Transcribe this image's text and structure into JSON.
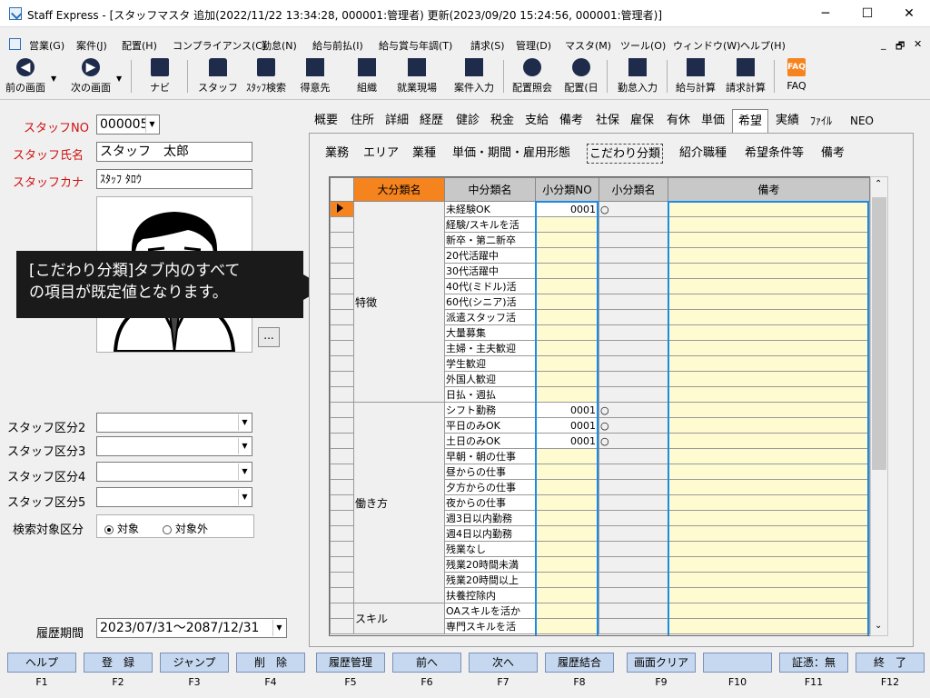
{
  "window": {
    "title": "Staff Express - [スタッフマスタ 追加(2022/11/22 13:34:28, 000001:管理者) 更新(2023/09/20 15:24:56, 000001:管理者)]",
    "minimize": "─",
    "maximize": "☐",
    "close": "✕"
  },
  "menu": [
    "営業(G)",
    "案件(J)",
    "配置(H)",
    "コンプライアンス(C)",
    "勤怠(N)",
    "給与前払(I)",
    "給与賞与年調(T)",
    "請求(S)",
    "管理(D)",
    "マスタ(M)",
    "ツール(O)",
    "ウィンドウ(W)",
    "ヘルプ(H)"
  ],
  "mdi_controls": [
    "_",
    "🗗",
    "✕"
  ],
  "toolbar": [
    "前の画面",
    "次の画面",
    "ナビ",
    "スタッフ",
    "ｽﾀｯﾌ検索",
    "得意先",
    "組織",
    "就業現場",
    "案件入力",
    "配置照会",
    "配置(日",
    "勤怠入力",
    "給与計算",
    "請求計算",
    "FAQ"
  ],
  "left": {
    "staff_no_label": "スタッフNO",
    "staff_no_value": "000005",
    "staff_name_label": "スタッフ氏名",
    "staff_name_value": "スタッフ　太郎",
    "staff_kana_label": "スタッフカナ",
    "staff_kana_value": "ｽﾀｯﾌ ﾀﾛｳ",
    "photo_button": "...",
    "kubun2": "スタッフ区分2",
    "kubun3": "スタッフ区分3",
    "kubun4": "スタッフ区分4",
    "kubun5": "スタッフ区分5",
    "search_label": "検索対象区分",
    "search_opt1": "対象",
    "search_opt2": "対象外",
    "history_label": "履歴期間",
    "history_value": "2023/07/31～2087/12/31"
  },
  "tooltip": {
    "line1": "[こだわり分類]タブ内のすべて",
    "line2": "の項目が既定値となります。"
  },
  "top_tabs": [
    "概要",
    "住所",
    "詳細",
    "経歴",
    "健診",
    "税金",
    "支給",
    "備考",
    "社保",
    "雇保",
    "有休",
    "単価",
    "希望",
    "実績",
    "ﾌｧｲﾙ",
    "NEO"
  ],
  "sub_tabs": [
    "業務",
    "エリア",
    "業種",
    "単価・期間・雇用形態",
    "こだわり分類",
    "紹介職種",
    "希望条件等",
    "備考"
  ],
  "grid": {
    "headers": [
      "大分類名",
      "中分類名",
      "小分類NO",
      "小分類名",
      "備考"
    ],
    "groups": [
      {
        "name": "特徴",
        "rows": [
          {
            "mid": "未経験OK",
            "no": "0001",
            "sn": "○"
          },
          {
            "mid": "経験/スキルを活",
            "no": "",
            "sn": ""
          },
          {
            "mid": "新卒・第二新卒",
            "no": "",
            "sn": ""
          },
          {
            "mid": "20代活躍中",
            "no": "",
            "sn": ""
          },
          {
            "mid": "30代活躍中",
            "no": "",
            "sn": ""
          },
          {
            "mid": "40代(ミドル)活",
            "no": "",
            "sn": ""
          },
          {
            "mid": "60代(シニア)活",
            "no": "",
            "sn": ""
          },
          {
            "mid": "派遣スタッフ活",
            "no": "",
            "sn": ""
          },
          {
            "mid": "大量募集",
            "no": "",
            "sn": ""
          },
          {
            "mid": "主婦・主夫歓迎",
            "no": "",
            "sn": ""
          },
          {
            "mid": "学生歓迎",
            "no": "",
            "sn": ""
          },
          {
            "mid": "外国人歓迎",
            "no": "",
            "sn": ""
          },
          {
            "mid": "日払・週払",
            "no": "",
            "sn": ""
          }
        ]
      },
      {
        "name": "働き方",
        "rows": [
          {
            "mid": "シフト勤務",
            "no": "0001",
            "sn": "○"
          },
          {
            "mid": "平日のみOK",
            "no": "0001",
            "sn": "○"
          },
          {
            "mid": "土日のみOK",
            "no": "0001",
            "sn": "○"
          },
          {
            "mid": "早朝・朝の仕事",
            "no": "",
            "sn": ""
          },
          {
            "mid": "昼からの仕事",
            "no": "",
            "sn": ""
          },
          {
            "mid": "夕方からの仕事",
            "no": "",
            "sn": ""
          },
          {
            "mid": "夜からの仕事",
            "no": "",
            "sn": ""
          },
          {
            "mid": "週3日以内勤務",
            "no": "",
            "sn": ""
          },
          {
            "mid": "週4日以内勤務",
            "no": "",
            "sn": ""
          },
          {
            "mid": "残業なし",
            "no": "",
            "sn": ""
          },
          {
            "mid": "残業20時間未満",
            "no": "",
            "sn": ""
          },
          {
            "mid": "残業20時間以上",
            "no": "",
            "sn": ""
          },
          {
            "mid": "扶養控除内",
            "no": "",
            "sn": ""
          }
        ]
      },
      {
        "name": "スキル",
        "rows": [
          {
            "mid": "OAスキルを活か",
            "no": "",
            "sn": ""
          },
          {
            "mid": "専門スキルを活",
            "no": "",
            "sn": ""
          }
        ]
      }
    ]
  },
  "fkeys": [
    {
      "label": "ヘルプ",
      "key": "F1"
    },
    {
      "label": "登　録",
      "key": "F2"
    },
    {
      "label": "ジャンプ",
      "key": "F3"
    },
    {
      "label": "削　除",
      "key": "F4"
    },
    {
      "label": "履歴管理",
      "key": "F5"
    },
    {
      "label": "前へ",
      "key": "F6"
    },
    {
      "label": "次へ",
      "key": "F7"
    },
    {
      "label": "履歴結合",
      "key": "F8"
    },
    {
      "label": "画面クリア",
      "key": "F9"
    },
    {
      "label": "",
      "key": "F10"
    },
    {
      "label": "証憑：無",
      "key": "F11"
    },
    {
      "label": "終　了",
      "key": "F12"
    }
  ],
  "colors": {
    "accent": "#f5841f",
    "highlight": "#1a8ce8",
    "required_label": "#d01010",
    "fkey_bg": "#c6d8f0",
    "cell_yellow": "#fffbd0"
  }
}
